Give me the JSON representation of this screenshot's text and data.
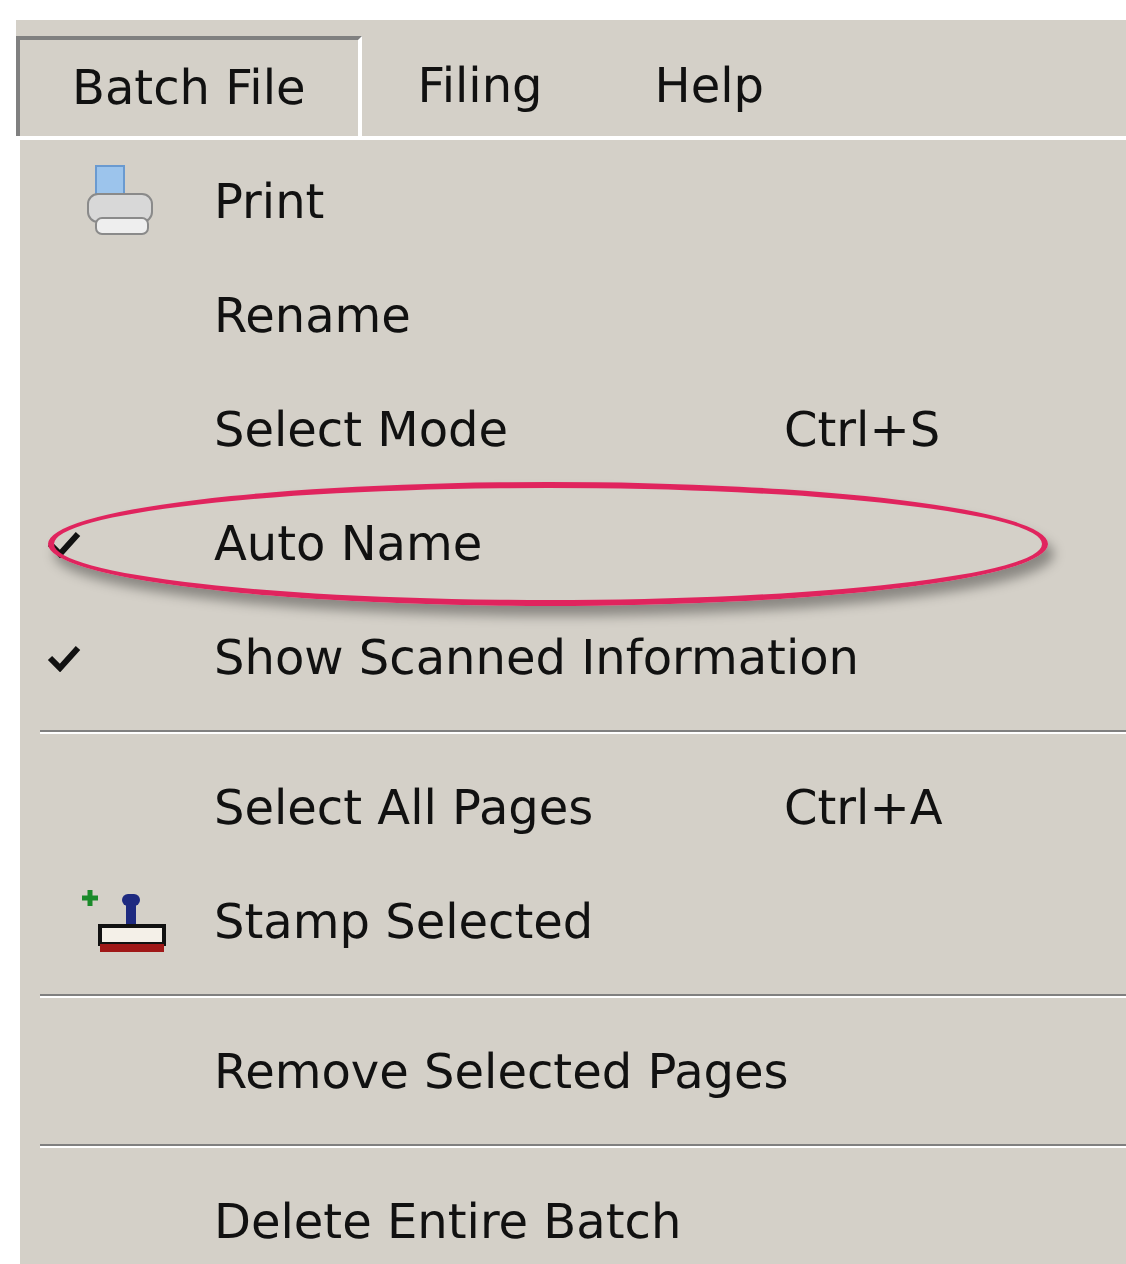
{
  "menubar": [
    {
      "label": "Batch File",
      "selected": true
    },
    {
      "label": "Filing",
      "selected": false
    },
    {
      "label": "Help",
      "selected": false
    }
  ],
  "menu": [
    {
      "kind": "printer",
      "label": "Print",
      "checked": false,
      "highlighted": false
    },
    {
      "kind": "item",
      "label": "Rename",
      "checked": false,
      "highlighted": false
    },
    {
      "kind": "item",
      "label": "Select Mode",
      "shortcut": "Ctrl+S",
      "checked": false,
      "highlighted": false
    },
    {
      "kind": "item",
      "label": "Auto Name",
      "checked": true,
      "highlighted": true
    },
    {
      "kind": "item",
      "label": "Show Scanned Information",
      "checked": true,
      "highlighted": false
    },
    {
      "kind": "separator"
    },
    {
      "kind": "item",
      "label": "Select All Pages",
      "shortcut": "Ctrl+A",
      "checked": false,
      "highlighted": false
    },
    {
      "kind": "stamp",
      "label": "Stamp Selected",
      "checked": false,
      "highlighted": false
    },
    {
      "kind": "separator"
    },
    {
      "kind": "item",
      "label": "Remove Selected Pages",
      "checked": false,
      "highlighted": false
    },
    {
      "kind": "separator"
    },
    {
      "kind": "item",
      "label": "Delete Entire Batch",
      "checked": false,
      "highlighted": false
    }
  ]
}
